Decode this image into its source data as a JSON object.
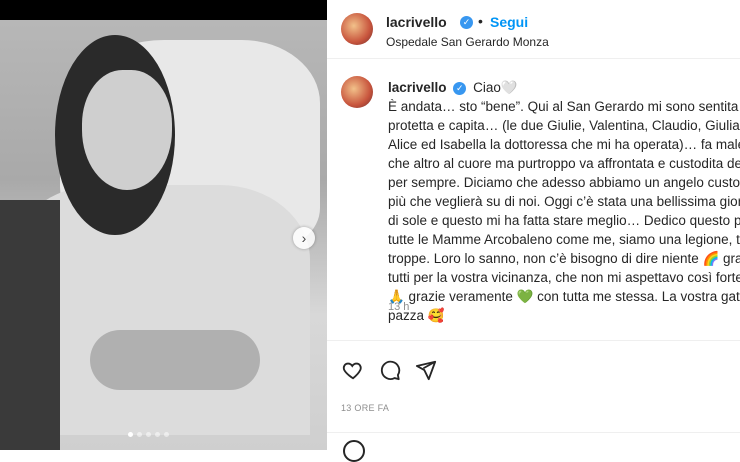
{
  "post": {
    "username": "lacrivello",
    "follow_label": "Segui",
    "location": "Ospedale San Gerardo Monza",
    "caption_lines": [
      "Ciao🤍",
      "È andata… sto “bene”. Qui al San Gerardo mi sono sentita",
      "protetta e capita… (le due Giulie, Valentina, Claudio, Giuliana,",
      "Alice ed Isabella la dottoressa che mi ha operata)… fa male, più",
      "che altro al cuore ma purtroppo va affrontata e custodita dent",
      "per sempre. Diciamo che adesso abbiamo un angelo custode i",
      "più che veglierà su di noi. Oggi c’è stata una bellissima giornat",
      "di sole e questo mi ha fatta stare meglio… Dedico questo post",
      "tutte le Mamme Arcobaleno come me, siamo una legione, tant",
      "troppe. Loro lo sanno, non c’è bisogno di dire niente 🌈 grazi",
      "tutti per la vostra vicinanza, che non mi aspettavo così forte 🤍",
      "🙏 grazie veramente 💚 con tutta me stessa. La vostra gatta",
      "pazza 🥰"
    ],
    "caption_time": "13 h",
    "posted_ago": "13 ORE FA"
  },
  "icons": {
    "like": "heart-icon",
    "comment": "comment-icon",
    "share": "share-icon",
    "verified": "verified-badge-icon",
    "next": "chevron-right-icon"
  },
  "colors": {
    "accent": "#0095f6",
    "verified": "#3897f0",
    "muted": "#8e8e8e"
  }
}
